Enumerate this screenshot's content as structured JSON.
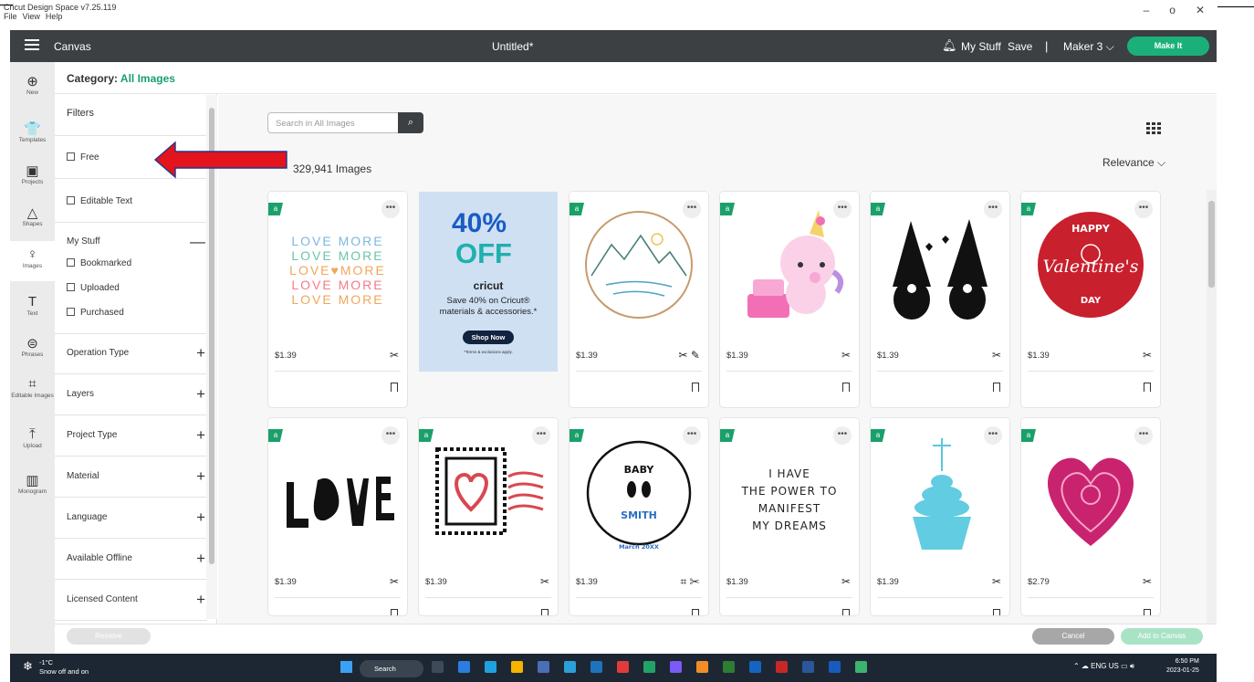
{
  "window": {
    "app_title": "Cricut Design Space v7.25.119",
    "menu": [
      "File",
      "View",
      "Help"
    ],
    "minimize": "–",
    "maximize": "o",
    "close": "✕"
  },
  "header": {
    "canvas": "Canvas",
    "document_title": "Untitled*",
    "my_stuff": "My Stuff",
    "save": "Save",
    "separator": "|",
    "machine": "Maker 3 ⌵",
    "make_it": "Make It"
  },
  "rail": [
    {
      "label": "New",
      "icon": "plus-circle-icon",
      "glyph": "⊕"
    },
    {
      "label": "Templates",
      "icon": "shirt-icon",
      "glyph": "👕"
    },
    {
      "label": "Projects",
      "icon": "projects-icon",
      "glyph": "▣"
    },
    {
      "label": "Shapes",
      "icon": "shapes-icon",
      "glyph": "△"
    },
    {
      "label": "Images",
      "icon": "lightbulb-icon",
      "glyph": "♀"
    },
    {
      "label": "Text",
      "icon": "text-icon",
      "glyph": "T"
    },
    {
      "label": "Phrases",
      "icon": "phrases-icon",
      "glyph": "⊜"
    },
    {
      "label": "Editable Images",
      "icon": "editable-images-icon",
      "glyph": "⌗"
    },
    {
      "label": "Upload",
      "icon": "upload-icon",
      "glyph": "⤒"
    },
    {
      "label": "Monogram",
      "icon": "monogram-icon",
      "glyph": "▥"
    }
  ],
  "category": {
    "prefix": "Category:",
    "name": "All Images"
  },
  "filters": {
    "title": "Filters",
    "free": "Free",
    "editable_text": "Editable Text",
    "my_stuff": "My Stuff",
    "bookmarked": "Bookmarked",
    "uploaded": "Uploaded",
    "purchased": "Purchased",
    "groups": [
      "Operation Type",
      "Layers",
      "Project Type",
      "Material",
      "Language",
      "Available Offline",
      "Licensed Content"
    ]
  },
  "main": {
    "search_placeholder": "Search in All Images",
    "count": "329,941 Images",
    "sort": "Relevance ⌵"
  },
  "promo": {
    "headline": "40%",
    "off": "OFF",
    "brand": "cricut",
    "text": "Save 40% on Cricut® materials & accessories.*",
    "cta": "Shop Now",
    "fine_print": "*Terms & exclusions apply."
  },
  "cards": [
    {
      "price": "$1.39",
      "art": "love-more",
      "text_lines": [
        "LOVE MORE",
        "LOVE MORE",
        "LOVE♥MORE",
        "LOVE MORE",
        "LOVE MORE"
      ]
    },
    {
      "price": "$1.39",
      "art": "mountain-landscape"
    },
    {
      "price": "$1.39",
      "art": "unicorn-cake"
    },
    {
      "price": "$1.39",
      "art": "gnomes"
    },
    {
      "price": "$1.39",
      "art": "happy-valentines-day",
      "text_lines": [
        "HAPPY",
        "Valentine's",
        "DAY"
      ]
    },
    {
      "price": "$1.39",
      "art": "sign-language-love"
    },
    {
      "price": "$1.39",
      "art": "heart-stamp"
    },
    {
      "price": "$1.39",
      "art": "baby-smith",
      "text_lines": [
        "BABY",
        "SMITH",
        "March 20XX"
      ]
    },
    {
      "price": "$1.39",
      "art": "manifest-dreams",
      "text_lines": [
        "I HAVE",
        "THE POWER TO",
        "MANIFEST",
        "MY DREAMS"
      ]
    },
    {
      "price": "$1.39",
      "art": "cupcake"
    },
    {
      "price": "$2.79",
      "art": "mandala-heart"
    }
  ],
  "footer": {
    "remove": "Remove",
    "cancel": "Cancel",
    "add": "Add to Canvas"
  },
  "taskbar": {
    "temp": "-1°C",
    "weather": "Snow off and on",
    "search": "Search",
    "lang": "ENG",
    "region": "US",
    "time": "6:50 PM",
    "date": "2023-01-25"
  },
  "colors": {
    "accent": "#1aa06a",
    "header": "#3c4043",
    "arrow": "#e3141b"
  }
}
